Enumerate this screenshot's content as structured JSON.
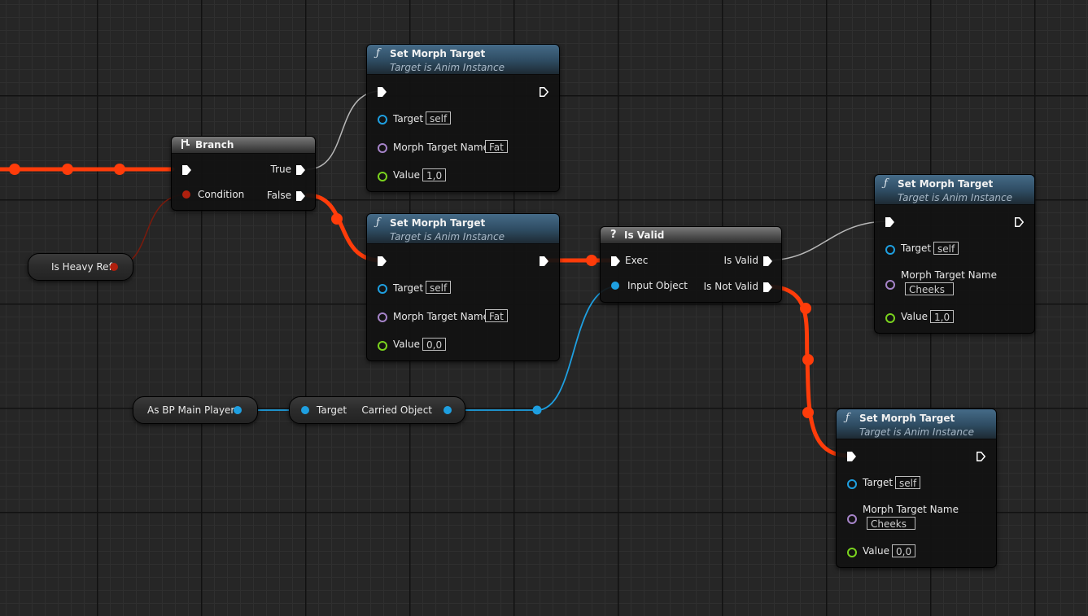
{
  "colors": {
    "exec_wire": "#ff3c0a",
    "object_pin": "#1e9fe0",
    "name_pin": "#a684c9",
    "float_pin": "#7ad31e",
    "bool_pin": "#b0200e",
    "function_header": "#3a5a73",
    "macro_header": "#5a5a5a"
  },
  "branch": {
    "title": "Branch",
    "icon": "branch-icon",
    "condition_label": "Condition",
    "true_label": "True",
    "false_label": "False"
  },
  "is_heavy_ref": {
    "label": "Is Heavy Ref"
  },
  "morph_top": {
    "title": "Set Morph Target",
    "subtitle": "Target is Anim Instance",
    "target_label": "Target",
    "target_value": "self",
    "name_label": "Morph Target Name",
    "name_value": "Fat",
    "value_label": "Value",
    "value_value": "1,0"
  },
  "morph_mid": {
    "title": "Set Morph Target",
    "subtitle": "Target is Anim Instance",
    "target_label": "Target",
    "target_value": "self",
    "name_label": "Morph Target Name",
    "name_value": "Fat",
    "value_label": "Value",
    "value_value": "0,0"
  },
  "is_valid": {
    "title": "Is Valid",
    "icon": "question-icon",
    "exec_label": "Exec",
    "input_label": "Input Object",
    "valid_label": "Is Valid",
    "not_valid_label": "Is Not Valid"
  },
  "morph_right": {
    "title": "Set Morph Target",
    "subtitle": "Target is Anim Instance",
    "target_label": "Target",
    "target_value": "self",
    "name_label": "Morph Target Name",
    "name_value": "Cheeks",
    "value_label": "Value",
    "value_value": "1,0"
  },
  "morph_bottom": {
    "title": "Set Morph Target",
    "subtitle": "Target is Anim Instance",
    "target_label": "Target",
    "target_value": "self",
    "name_label": "Morph Target Name",
    "name_value": "Cheeks",
    "value_label": "Value",
    "value_value": "0,0"
  },
  "as_bp_main_player": {
    "label": "As BP Main Player"
  },
  "carried_object": {
    "target_label": "Target",
    "output_label": "Carried Object"
  },
  "function_icon": "function-icon"
}
